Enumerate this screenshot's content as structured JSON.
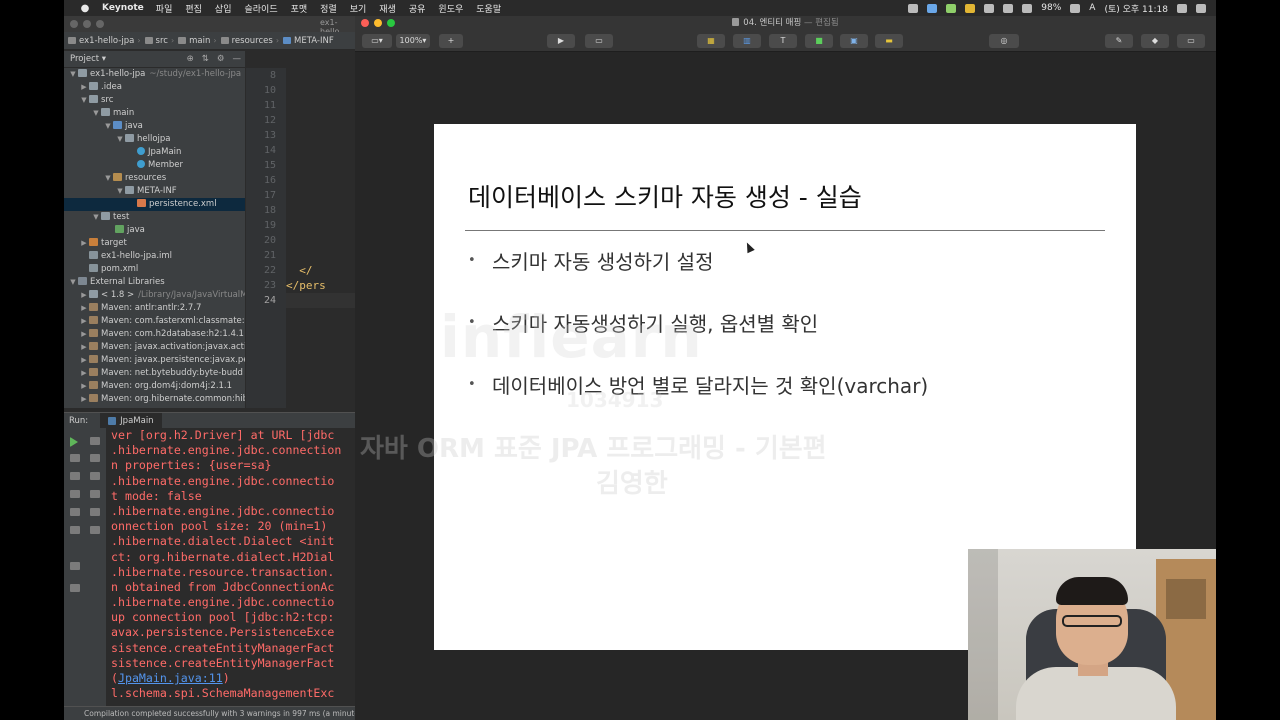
{
  "menubar": {
    "app": "Keynote",
    "items": [
      "파일",
      "편집",
      "삽입",
      "슬라이드",
      "포맷",
      "정렬",
      "보기",
      "재생",
      "공유",
      "윈도우",
      "도움말"
    ],
    "battery": "98%",
    "input_mode": "A",
    "clock": "(토) 오후 11:18"
  },
  "intellij": {
    "window_title": "ex1-hello",
    "breadcrumbs": [
      "ex1-hello-jpa",
      "src",
      "main",
      "resources",
      "META-INF"
    ],
    "project_panel_title": "Project",
    "tree": [
      {
        "label": "ex1-hello-jpa",
        "extra": "~/study/ex1-hello-jpa"
      },
      {
        "label": ".idea"
      },
      {
        "label": "src"
      },
      {
        "label": "main"
      },
      {
        "label": "java"
      },
      {
        "label": "hellojpa"
      },
      {
        "label": "JpaMain"
      },
      {
        "label": "Member"
      },
      {
        "label": "resources"
      },
      {
        "label": "META-INF"
      },
      {
        "label": "persistence.xml"
      },
      {
        "label": "test"
      },
      {
        "label": "java"
      },
      {
        "label": "target"
      },
      {
        "label": "ex1-hello-jpa.iml"
      },
      {
        "label": "pom.xml"
      },
      {
        "label": "External Libraries"
      },
      {
        "label": "< 1.8 >",
        "extra": "/Library/Java/JavaVirtualM"
      },
      {
        "label": "Maven: antlr:antlr:2.7.7"
      },
      {
        "label": "Maven: com.fasterxml:classmate:"
      },
      {
        "label": "Maven: com.h2database:h2:1.4.1"
      },
      {
        "label": "Maven: javax.activation:javax.activ"
      },
      {
        "label": "Maven: javax.persistence:javax.pe"
      },
      {
        "label": "Maven: net.bytebuddy:byte-budd"
      },
      {
        "label": "Maven: org.dom4j:dom4j:2.1.1"
      },
      {
        "label": "Maven: org.hibernate.common:hib"
      }
    ],
    "line_numbers": [
      "8",
      "10",
      "11",
      "12",
      "13",
      "14",
      "15",
      "16",
      "17",
      "18",
      "19",
      "20",
      "21",
      "22",
      "23",
      "24"
    ],
    "code_lines": [
      "",
      "",
      "",
      "",
      "",
      "",
      "",
      "",
      "",
      "",
      "",
      "",
      "",
      "  </",
      "</pers",
      ""
    ],
    "run_label": "Run:",
    "run_tab": "JpaMain",
    "console_lines": [
      "ver [org.h2.Driver] at URL [jdbc",
      ".hibernate.engine.jdbc.connection",
      "n properties: {user=sa}",
      ".hibernate.engine.jdbc.connectio",
      "t mode: false",
      ".hibernate.engine.jdbc.connectio",
      "onnection pool size: 20 (min=1)",
      ".hibernate.dialect.Dialect <init",
      "ct: org.hibernate.dialect.H2Dial",
      ".hibernate.resource.transaction.",
      "n obtained from JdbcConnectionAc",
      ".hibernate.engine.jdbc.connectio",
      "up connection pool [jdbc:h2:tcp:",
      "avax.persistence.PersistenceExce",
      "sistence.createEntityManagerFact",
      "sistence.createEntityManagerFact"
    ],
    "console_link": "JpaMain.java:11",
    "console_last": "l.schema.spi.SchemaManagementExc",
    "status": "Compilation completed successfully with 3 warnings in 997 ms (a minute ag"
  },
  "keynote": {
    "doc_title": "04. 엔티티 매핑",
    "edited_label": "— 편집됨",
    "zoom": "100%",
    "slide": {
      "title": "데이터베이스 스키마 자동 생성 - 실습",
      "bullets": [
        "스키마 자동 생성하기 설정",
        "스키마 자동생성하기 실행, 옵션별 확인",
        "데이터베이스 방언 별로 달라지는 것 확인(varchar)"
      ]
    },
    "watermark": {
      "logo": "inflearn",
      "number": "1034913",
      "course": "자바 ORM 표준 JPA 프로그래밍 - 기본편",
      "name": "김영한"
    }
  }
}
